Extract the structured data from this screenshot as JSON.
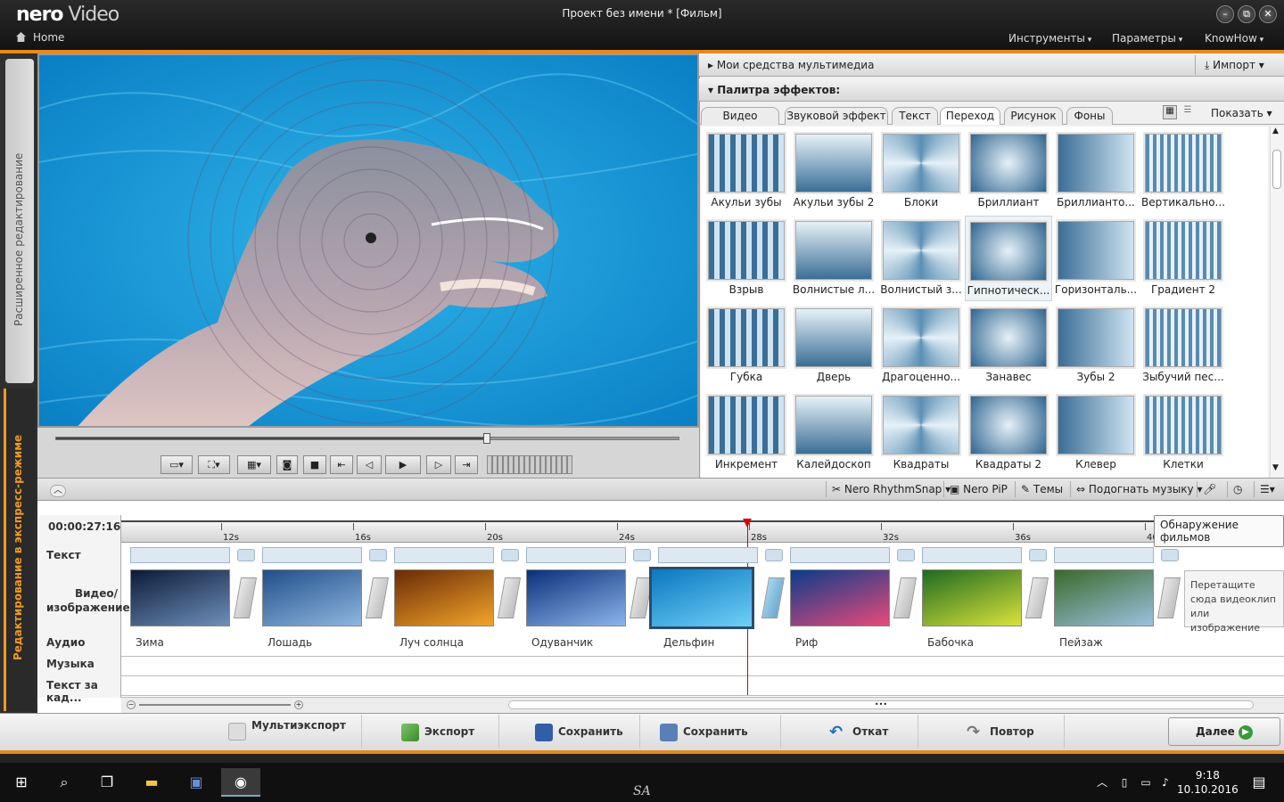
{
  "app": {
    "brand": "nero",
    "product": "Video",
    "document_title": "Проект без имени * [Фильм]",
    "home_label": "Home"
  },
  "menu": {
    "tools": "Инструменты",
    "params": "Параметры",
    "knowhow": "KnowHow"
  },
  "window_buttons": [
    "minimize",
    "restore",
    "close"
  ],
  "side_tabs": {
    "advanced": "Расширенное редактирование",
    "express": "Редактирование в экспресс-режиме"
  },
  "media": {
    "my_media": "Мои средства мультимедиа",
    "import": "Импорт",
    "palette": "Палитра эффектов:",
    "show": "Показать"
  },
  "effect_tabs": [
    "Видео эффект",
    "Звуковой эффект",
    "Текст",
    "Переход",
    "Рисунок",
    "Фоны"
  ],
  "selected_tab": "Переход",
  "effects": [
    "Акульи зубы",
    "Акульи зубы 2",
    "Блоки",
    "Бриллиант",
    "Бриллианто...",
    "Вертикально...",
    "Взрыв",
    "Волнистые л...",
    "Волнистый з...",
    "Гипнотическ...",
    "Горизонталь...",
    "Градиент 2",
    "Губка",
    "Дверь",
    "Драгоценно...",
    "Занавес",
    "Зубы 2",
    "Зыбучий пес...",
    "Инкремент",
    "Калейдоскоп",
    "Квадраты",
    "Квадраты 2",
    "Клевер",
    "Клетки"
  ],
  "selected_effect": "Гипнотическ...",
  "toolstrip": {
    "rhythm": "Nero RhythmSnap",
    "pip": "Nero PiP",
    "themes": "Темы",
    "fit_music": "Подогнать музыку"
  },
  "timeline": {
    "timecode": "00:00:27:16",
    "tracks": {
      "text": "Текст",
      "video": "Видео/ изображение",
      "audio": "Аудио",
      "music": "Музыка",
      "caption": "Текст за кад..."
    },
    "ruler": [
      "12s",
      "16s",
      "20s",
      "24s",
      "28s",
      "32s",
      "36s",
      "40s"
    ],
    "clips": [
      "Зима",
      "Лошадь",
      "Луч солнца",
      "Одуванчик",
      "Дельфин",
      "Риф",
      "Бабочка",
      "Пейзаж"
    ],
    "selected_clip": "Дельфин",
    "drop_hint": "Перетащите сюда видеоклип или изображение",
    "tooltip": "Обнаружение фильмов"
  },
  "bottom": {
    "multi": "Мультиэкспорт",
    "export": "Экспорт",
    "save": "Сохранить",
    "save_as": "Сохранить как...",
    "undo": "Откат",
    "redo": "Повтор",
    "next": "Далее"
  },
  "taskbar": {
    "time": "9:18",
    "date": "10.10.2016",
    "center": "SA"
  },
  "colors": {
    "accent": "#e58a1f",
    "tile_blue": "#4a7fa4"
  }
}
